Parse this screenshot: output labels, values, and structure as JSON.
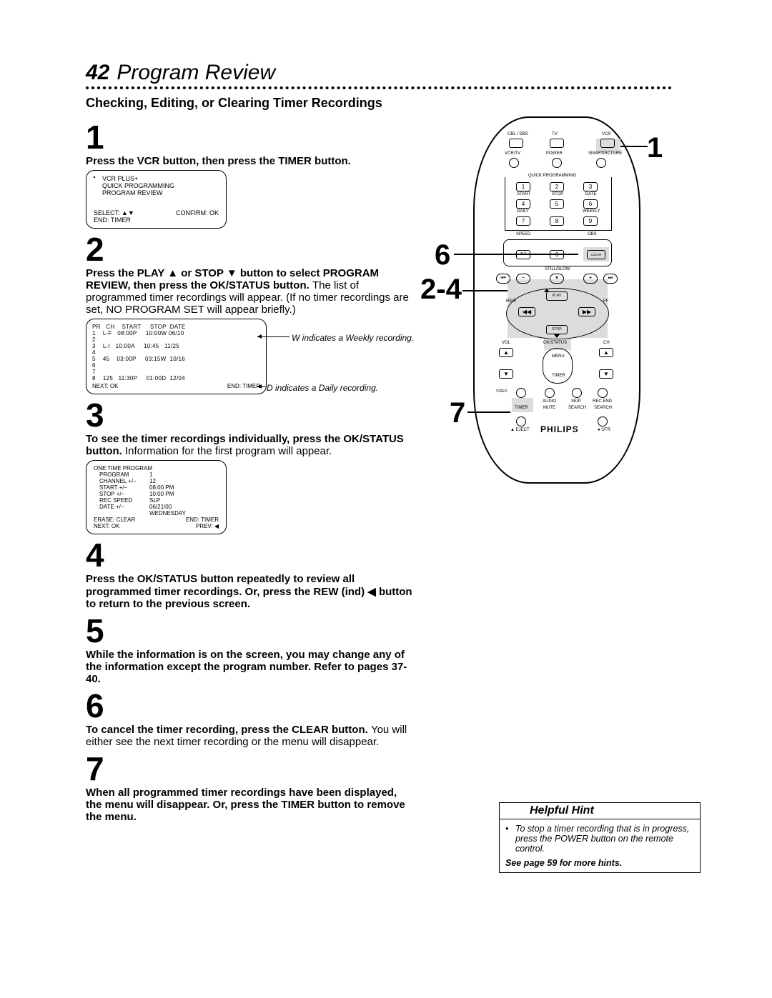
{
  "page_number": "42",
  "page_title": "Program Review",
  "subtitle": "Checking, Editing, or Clearing Timer Recordings",
  "steps": {
    "s1": {
      "num": "1",
      "text_bold": "Press the VCR button, then press the TIMER button."
    },
    "s2": {
      "num": "2",
      "text_bold": "Press the PLAY ▲ or STOP ▼ button to select PROGRAM REVIEW, then press the OK/STATUS button. ",
      "text_rest": "The list of programmed timer recordings will appear. (If no timer recordings are set, NO PROGRAM SET will appear briefly.)"
    },
    "s3": {
      "num": "3",
      "text_bold": "To see the timer recordings individually, press the OK/STATUS button. ",
      "text_rest": "Information for the first program will appear."
    },
    "s4": {
      "num": "4",
      "text_bold": "Press the OK/STATUS button repeatedly to review all programmed timer recordings. Or, press the REW (ind) ◀ button to return to the previous screen."
    },
    "s5": {
      "num": "5",
      "text_bold": "While the information is on the screen, you may change any of the information except the program number.  Refer to pages 37-40."
    },
    "s6": {
      "num": "6",
      "text_bold": "To cancel the timer recording, press the CLEAR button. ",
      "text_rest": "You will either see the next timer recording or the menu will disappear."
    },
    "s7": {
      "num": "7",
      "text_bold": "When all programmed timer recordings have been displayed, the menu will disappear. Or, press the TIMER button to remove the menu."
    }
  },
  "screen1": {
    "l1": "VCR PLUS+",
    "l2": "QUICK PROGRAMMING",
    "l3": "PROGRAM REVIEW",
    "l4a": "SELECT: ▲▼",
    "l4b": "CONFIRM: OK",
    "l5": "END: TIMER"
  },
  "screen2": {
    "hdr": "PR   CH    START     STOP  DATE",
    "rows": [
      "1    L-F   08:00P     10:00W 06/10",
      "2",
      "3    L-I   10:00A     10:45   11/25",
      "4",
      "5    45    03:00P     03:15W  10/16",
      "6",
      "7",
      "8    125   11:30P     01:00D  12/04"
    ],
    "foot_l": "NEXT: OK",
    "foot_r": "END: TIMER"
  },
  "note_w": "W indicates a Weekly recording.",
  "note_d": "D indicates a Daily recording.",
  "screen3": {
    "l1": "ONE TIME PROGRAM",
    "l2a": "PROGRAM",
    "l2b": "1",
    "l3a": "CHANNEL +/−",
    "l3b": "12",
    "l4a": "START +/−",
    "l4b": "08:00  PM",
    "l5a": "STOP +/−",
    "l5b": "10:00  PM",
    "l6a": "REC SPEED",
    "l6b": "SLP",
    "l7a": "DATE +/−",
    "l7b": "06/21/00",
    "l8": "WEDNESDAY",
    "l9a": "ERASE: CLEAR",
    "l9b": "END: TIMER",
    "l10a": "NEXT: OK",
    "l10b": "PREV: ◀"
  },
  "remote": {
    "top_row": {
      "l": "CBL / DBS",
      "c": "TV",
      "r": "VCR"
    },
    "second_row": {
      "l": "VCR/TV",
      "c": "POWER",
      "r": "SMARTPICTURE"
    },
    "qp": "QUICK PROGRAMMING",
    "numpad": [
      "1",
      "2",
      "3",
      "4",
      "5",
      "6",
      "7",
      "8",
      "9",
      "0"
    ],
    "qp_under1": {
      "l": "START",
      "c": "STOP",
      "r": "DATE"
    },
    "qp_under2": {
      "l": "DAILY",
      "c": "",
      "r": "WEEKLY"
    },
    "speed": "SPEED",
    "obs": "OBS",
    "alt": "ALT",
    "clear": "CLEAR",
    "still": "STILL/SLOW",
    "rew": "REW",
    "play": "PLAY",
    "ff": "FF",
    "stop": "STOP",
    "vol": "VOL",
    "ok": "OK/STATUS",
    "ch": "CH",
    "menu": "MENU",
    "timer": "TIMER",
    "row_bottom": {
      "a": "AUDIO",
      "b": "SKIP",
      "c": "REC END"
    },
    "row_bottom2": {
      "a": "TIMER",
      "b": "MUTE",
      "c": "SEARCH",
      "d": "SEARCH"
    },
    "eject": "▲ EJECT",
    "otr": "● OTR",
    "brand": "PHILIPS",
    "video": "VIDEO"
  },
  "callouts": {
    "c1": "1",
    "c6": "6",
    "c24": "2-4",
    "c7": "7"
  },
  "hint": {
    "header": "Helpful Hint",
    "body": "To stop a timer recording that is in progress, press the POWER button on the remote control.",
    "footer": "See page 59 for more hints."
  }
}
